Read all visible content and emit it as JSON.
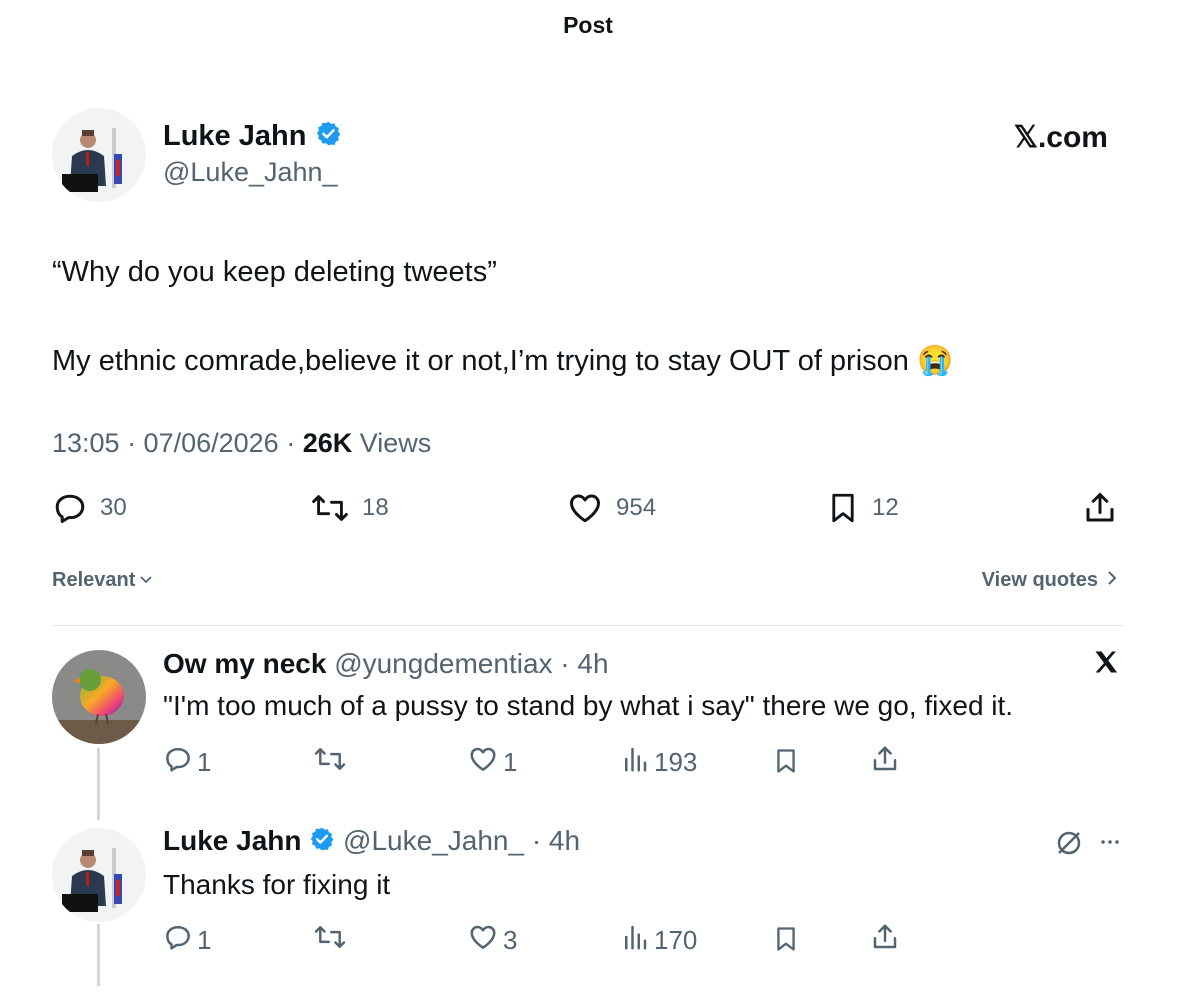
{
  "header": {
    "title": "Post"
  },
  "post": {
    "author_name": "Luke Jahn",
    "handle": "@Luke_Jahn_",
    "brand": "𝕏.com",
    "line1": "“Why do you keep deleting tweets”",
    "line2": "My ethnic comrade,believe it or not,I’m trying to stay OUT of prison 😭",
    "time": "13:05 · 07/06/2026 · ",
    "views_count": "26K",
    "views_label": " Views",
    "stats": {
      "replies": "30",
      "reposts": "18",
      "likes": "954",
      "bookmarks": "12"
    }
  },
  "filter": {
    "sort_label": "Relevant",
    "quotes_label": "View quotes"
  },
  "replies": [
    {
      "name": "Ow my neck",
      "meta": "@yungdementiax · 4h",
      "text": "\"I'm too much of a pussy to stand by what i say\" there we go, fixed it.",
      "replies": "1",
      "reposts": "",
      "likes": "1",
      "views": "193"
    },
    {
      "name": "Luke Jahn",
      "meta": "@Luke_Jahn_ · 4h",
      "text": "Thanks for fixing it",
      "replies": "1",
      "reposts": "",
      "likes": "3",
      "views": "170"
    }
  ],
  "colors": {
    "verified": "#1d9bf0",
    "text": "#0f1419",
    "muted": "#536471"
  },
  "icons": [
    "verified-badge-icon",
    "x-logo-icon",
    "reply-icon",
    "repost-icon",
    "like-icon",
    "bookmark-icon",
    "share-icon",
    "chevron-down-icon",
    "chevron-right-icon",
    "views-icon",
    "hidden-icon",
    "more-icon",
    "crying-emoji-icon"
  ]
}
